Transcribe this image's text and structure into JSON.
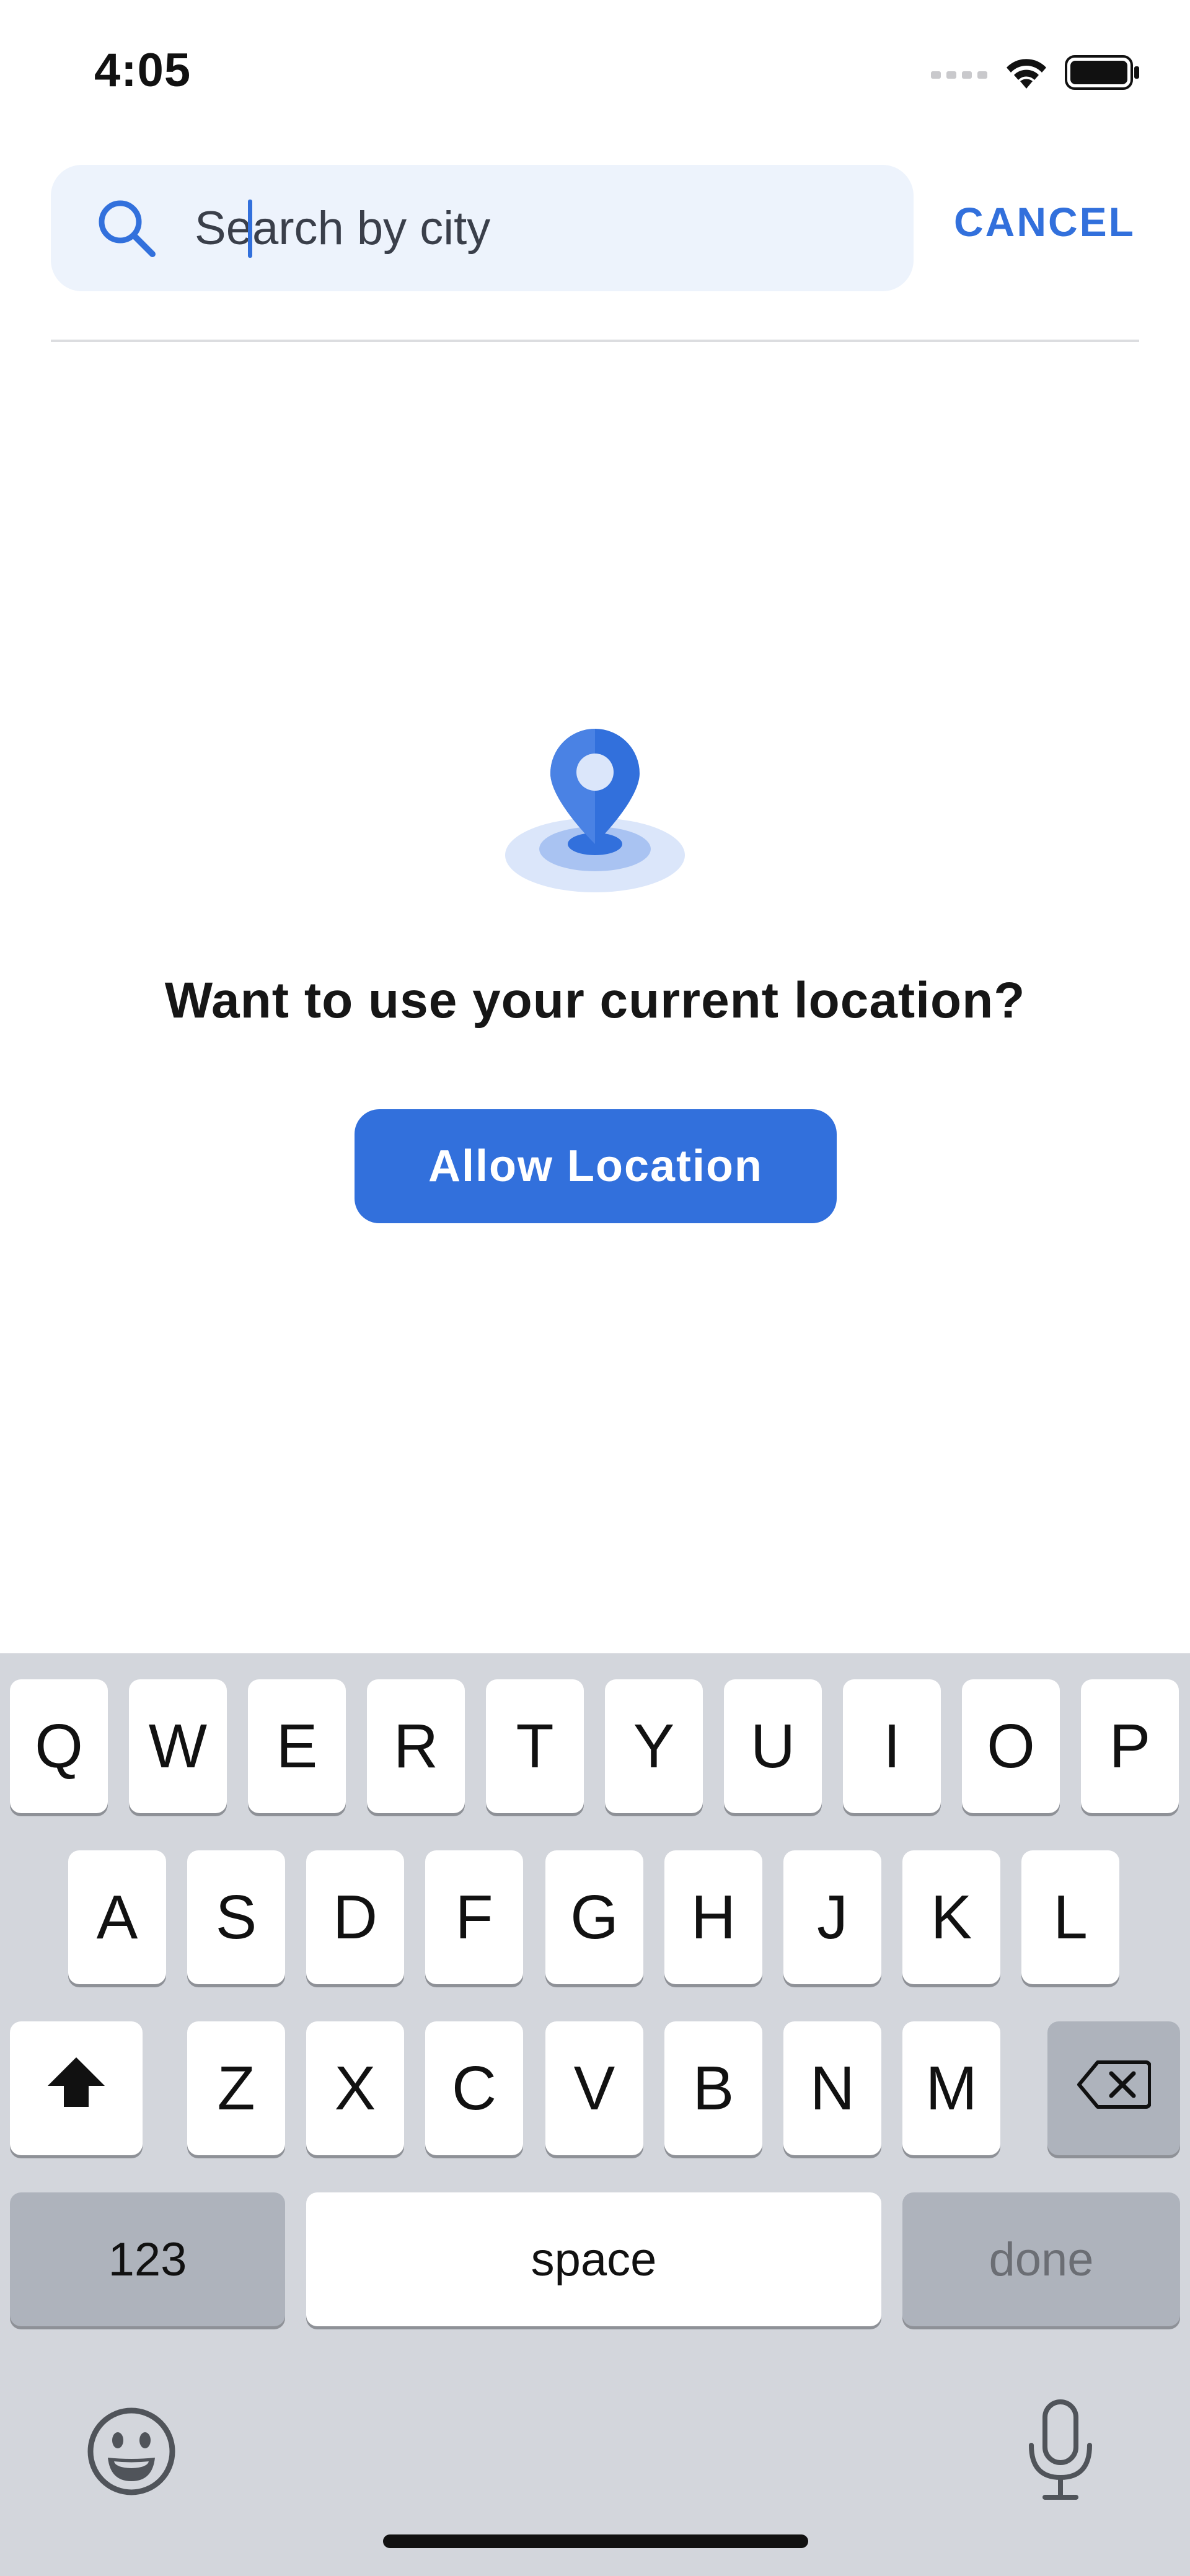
{
  "status_bar": {
    "time": "4:05",
    "icons": [
      "cellular-signal-icon",
      "wifi-icon",
      "battery-icon"
    ]
  },
  "search": {
    "placeholder": "Search by city",
    "value": "",
    "cancel_label": "CANCEL"
  },
  "empty_state": {
    "icon": "location-pin-icon",
    "prompt": "Want to use your current location?",
    "allow_label": "Allow Location"
  },
  "keyboard": {
    "row1": [
      "Q",
      "W",
      "E",
      "R",
      "T",
      "Y",
      "U",
      "I",
      "O",
      "P"
    ],
    "row2": [
      "A",
      "S",
      "D",
      "F",
      "G",
      "H",
      "J",
      "K",
      "L"
    ],
    "row3": [
      "Z",
      "X",
      "C",
      "V",
      "B",
      "N",
      "M"
    ],
    "numbers_label": "123",
    "space_label": "space",
    "done_label": "done",
    "icons": [
      "shift-icon",
      "backspace-icon",
      "emoji-icon",
      "microphone-icon"
    ]
  },
  "colors": {
    "accent": "#3270dc",
    "search_background": "#edf3fc",
    "keyboard_background": "#d3d6dc",
    "special_key": "#aeb3bc"
  }
}
